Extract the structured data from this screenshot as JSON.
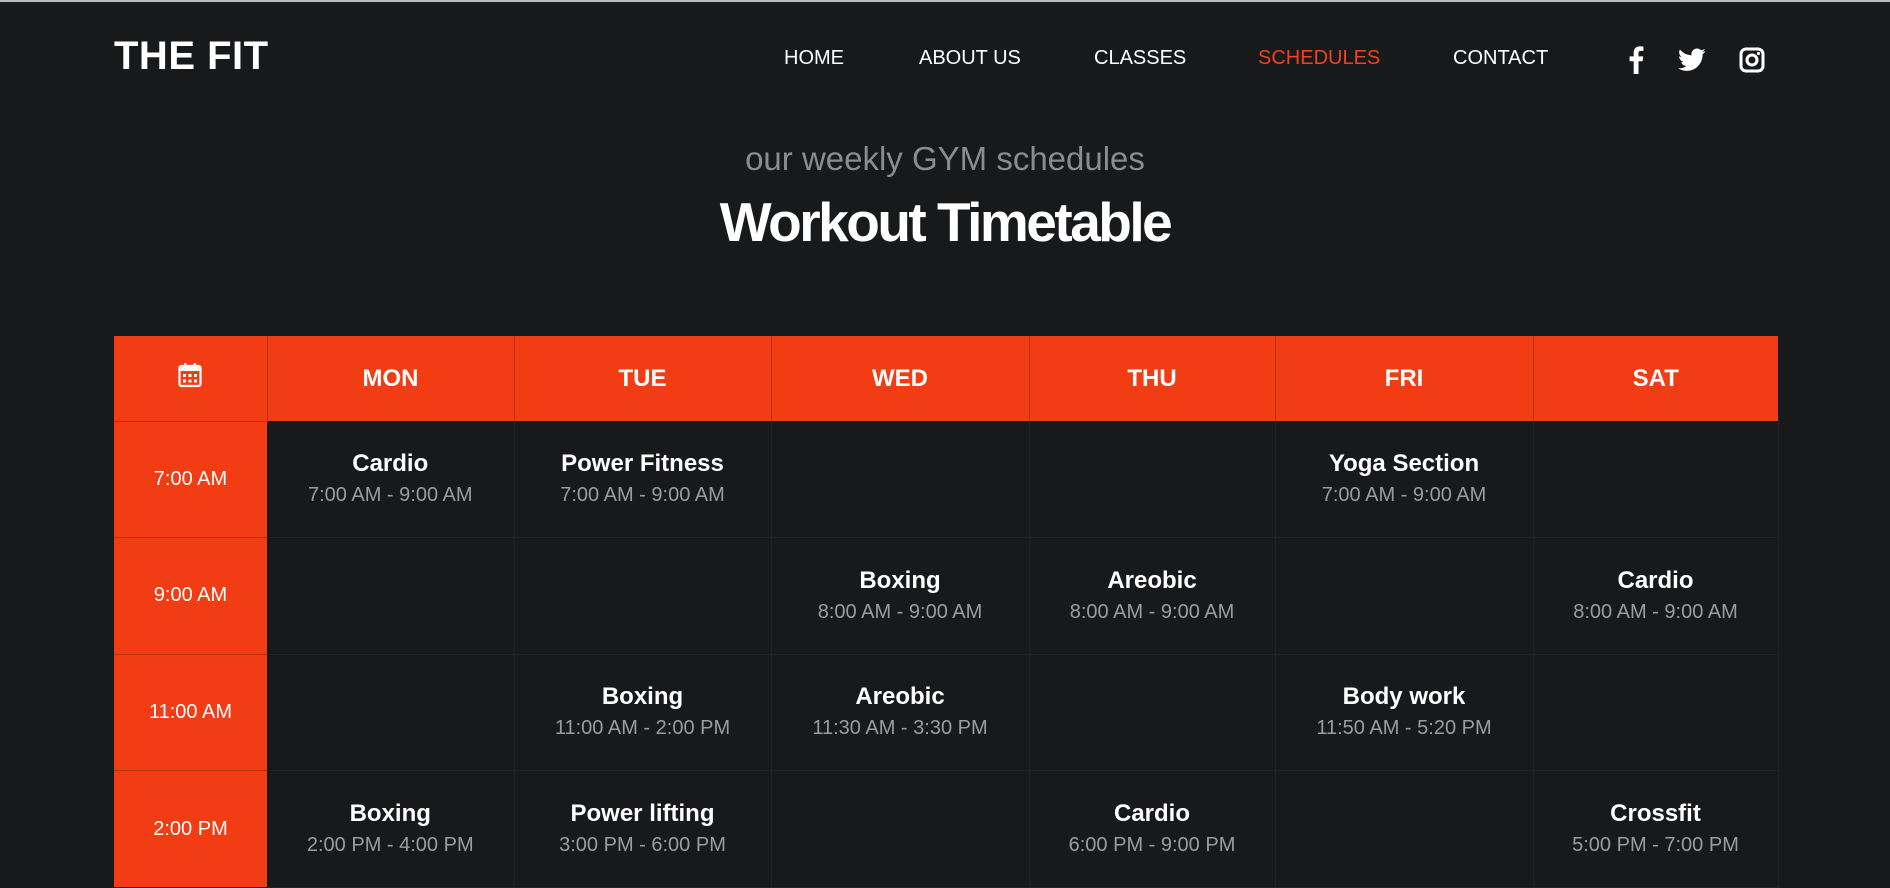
{
  "brand": {
    "logo": "THE FIT",
    "accent_color": "#f23c14"
  },
  "nav": {
    "items": [
      {
        "label": "HOME",
        "active": false
      },
      {
        "label": "ABOUT US",
        "active": false
      },
      {
        "label": "CLASSES",
        "active": false
      },
      {
        "label": "SCHEDULES",
        "active": true
      },
      {
        "label": "CONTACT",
        "active": false
      }
    ],
    "social": [
      "facebook-icon",
      "twitter-icon",
      "instagram-icon"
    ]
  },
  "hero": {
    "subtitle": "our weekly GYM schedules",
    "title": "Workout Timetable"
  },
  "timetable": {
    "header_icon": "calendar-icon",
    "days": [
      "MON",
      "TUE",
      "WED",
      "THU",
      "FRI",
      "SAT"
    ],
    "rows": [
      {
        "time": "7:00 AM",
        "slots": [
          {
            "name": "Cardio",
            "time": "7:00 AM - 9:00 AM"
          },
          {
            "name": "Power Fitness",
            "time": "7:00 AM - 9:00 AM"
          },
          null,
          null,
          {
            "name": "Yoga Section",
            "time": "7:00 AM - 9:00 AM"
          },
          null
        ]
      },
      {
        "time": "9:00 AM",
        "slots": [
          null,
          null,
          {
            "name": "Boxing",
            "time": "8:00 AM - 9:00 AM"
          },
          {
            "name": "Areobic",
            "time": "8:00 AM - 9:00 AM"
          },
          null,
          {
            "name": "Cardio",
            "time": "8:00 AM - 9:00 AM"
          }
        ]
      },
      {
        "time": "11:00 AM",
        "slots": [
          null,
          {
            "name": "Boxing",
            "time": "11:00 AM - 2:00 PM"
          },
          {
            "name": "Areobic",
            "time": "11:30 AM - 3:30 PM"
          },
          null,
          {
            "name": "Body work",
            "time": "11:50 AM - 5:20 PM"
          },
          null
        ]
      },
      {
        "time": "2:00 PM",
        "slots": [
          {
            "name": "Boxing",
            "time": "2:00 PM - 4:00 PM"
          },
          {
            "name": "Power lifting",
            "time": "3:00 PM - 6:00 PM"
          },
          null,
          {
            "name": "Cardio",
            "time": "6:00 PM - 9:00 PM"
          },
          null,
          {
            "name": "Crossfit",
            "time": "5:00 PM - 7:00 PM"
          }
        ]
      }
    ]
  }
}
